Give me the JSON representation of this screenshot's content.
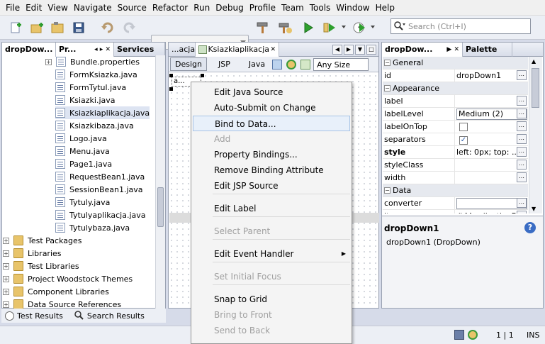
{
  "menubar": [
    "File",
    "Edit",
    "View",
    "Navigate",
    "Source",
    "Refactor",
    "Run",
    "Debug",
    "Profile",
    "Team",
    "Tools",
    "Window",
    "Help"
  ],
  "search": {
    "placeholder": "Search (Ctrl+I)"
  },
  "left_tabs": [
    "dropDow...",
    "Pr...",
    "Services"
  ],
  "tree": [
    {
      "label": "Bundle.properties",
      "type": "file"
    },
    {
      "label": "FormKsiazka.java",
      "type": "java"
    },
    {
      "label": "FormTytul.java",
      "type": "java"
    },
    {
      "label": "Ksiazki.java",
      "type": "java"
    },
    {
      "label": "Ksiazkiaplikacja.java",
      "type": "java",
      "selected": true
    },
    {
      "label": "Ksiazkibaza.java",
      "type": "java"
    },
    {
      "label": "Logo.java",
      "type": "java"
    },
    {
      "label": "Menu.java",
      "type": "java"
    },
    {
      "label": "Page1.java",
      "type": "java"
    },
    {
      "label": "RequestBean1.java",
      "type": "java"
    },
    {
      "label": "SessionBean1.java",
      "type": "java"
    },
    {
      "label": "Tytuly.java",
      "type": "java"
    },
    {
      "label": "Tytulyaplikacja.java",
      "type": "java"
    },
    {
      "label": "Tytulybaza.java",
      "type": "java"
    },
    {
      "label": "Test Packages",
      "type": "folder"
    },
    {
      "label": "Libraries",
      "type": "folder"
    },
    {
      "label": "Test Libraries",
      "type": "folder"
    },
    {
      "label": "Project Woodstock Themes",
      "type": "folder"
    },
    {
      "label": "Component Libraries",
      "type": "folder"
    },
    {
      "label": "Data Source References",
      "type": "folder"
    }
  ],
  "bottom_tabs": [
    "Test Results",
    "Search Results"
  ],
  "editor": {
    "tabs": [
      "...acja",
      "Ksiazkiaplikacja"
    ],
    "view_tabs": [
      "Design",
      "JSP",
      "Java"
    ],
    "size": "Any Size",
    "component_text": "a..."
  },
  "context_menu": [
    {
      "label": "Edit Java Source",
      "enabled": true
    },
    {
      "label": "Auto-Submit on Change",
      "enabled": true
    },
    {
      "label": "Bind to Data...",
      "enabled": true,
      "highlighted": true
    },
    {
      "label": "Add",
      "enabled": false
    },
    {
      "label": "Property Bindings...",
      "enabled": true
    },
    {
      "label": "Remove Binding Attribute",
      "enabled": true
    },
    {
      "label": "Edit JSP Source",
      "enabled": true
    },
    {
      "sep": true
    },
    {
      "label": "Edit Label",
      "enabled": true
    },
    {
      "sep": true
    },
    {
      "label": "Select Parent",
      "enabled": false
    },
    {
      "sep": true
    },
    {
      "label": "Edit Event Handler",
      "enabled": true,
      "submenu": true
    },
    {
      "sep": true
    },
    {
      "label": "Set Initial Focus",
      "enabled": false
    },
    {
      "sep": true
    },
    {
      "label": "Snap to Grid",
      "enabled": true
    },
    {
      "label": "Bring to Front",
      "enabled": false
    },
    {
      "label": "Send to Back",
      "enabled": false
    }
  ],
  "props_tabs": [
    "dropDow...",
    "Palette"
  ],
  "props": [
    {
      "cat": "General"
    },
    {
      "k": "id",
      "v": "dropDown1",
      "btn": true
    },
    {
      "cat": "Appearance"
    },
    {
      "k": "label",
      "v": "",
      "btn": true
    },
    {
      "k": "labelLevel",
      "v": "Medium (2)",
      "combo": true,
      "btn": true
    },
    {
      "k": "labelOnTop",
      "check": false,
      "btn": true
    },
    {
      "k": "separators",
      "check": true,
      "btn": true
    },
    {
      "k": "style",
      "v": "left: 0px; top: ...",
      "bold": true,
      "btn": true
    },
    {
      "k": "styleClass",
      "v": "",
      "btn": true
    },
    {
      "k": "width",
      "v": "",
      "btn": true
    },
    {
      "cat": "Data"
    },
    {
      "k": "converter",
      "v": "",
      "combo": true,
      "btn": true
    },
    {
      "k": "it...",
      "v": "#{ApplicationB...",
      "btn": true
    }
  ],
  "help": {
    "title": "dropDown1",
    "desc": "dropDown1 (DropDown)"
  },
  "status": {
    "pos": "1 | 1",
    "mode": "INS"
  }
}
